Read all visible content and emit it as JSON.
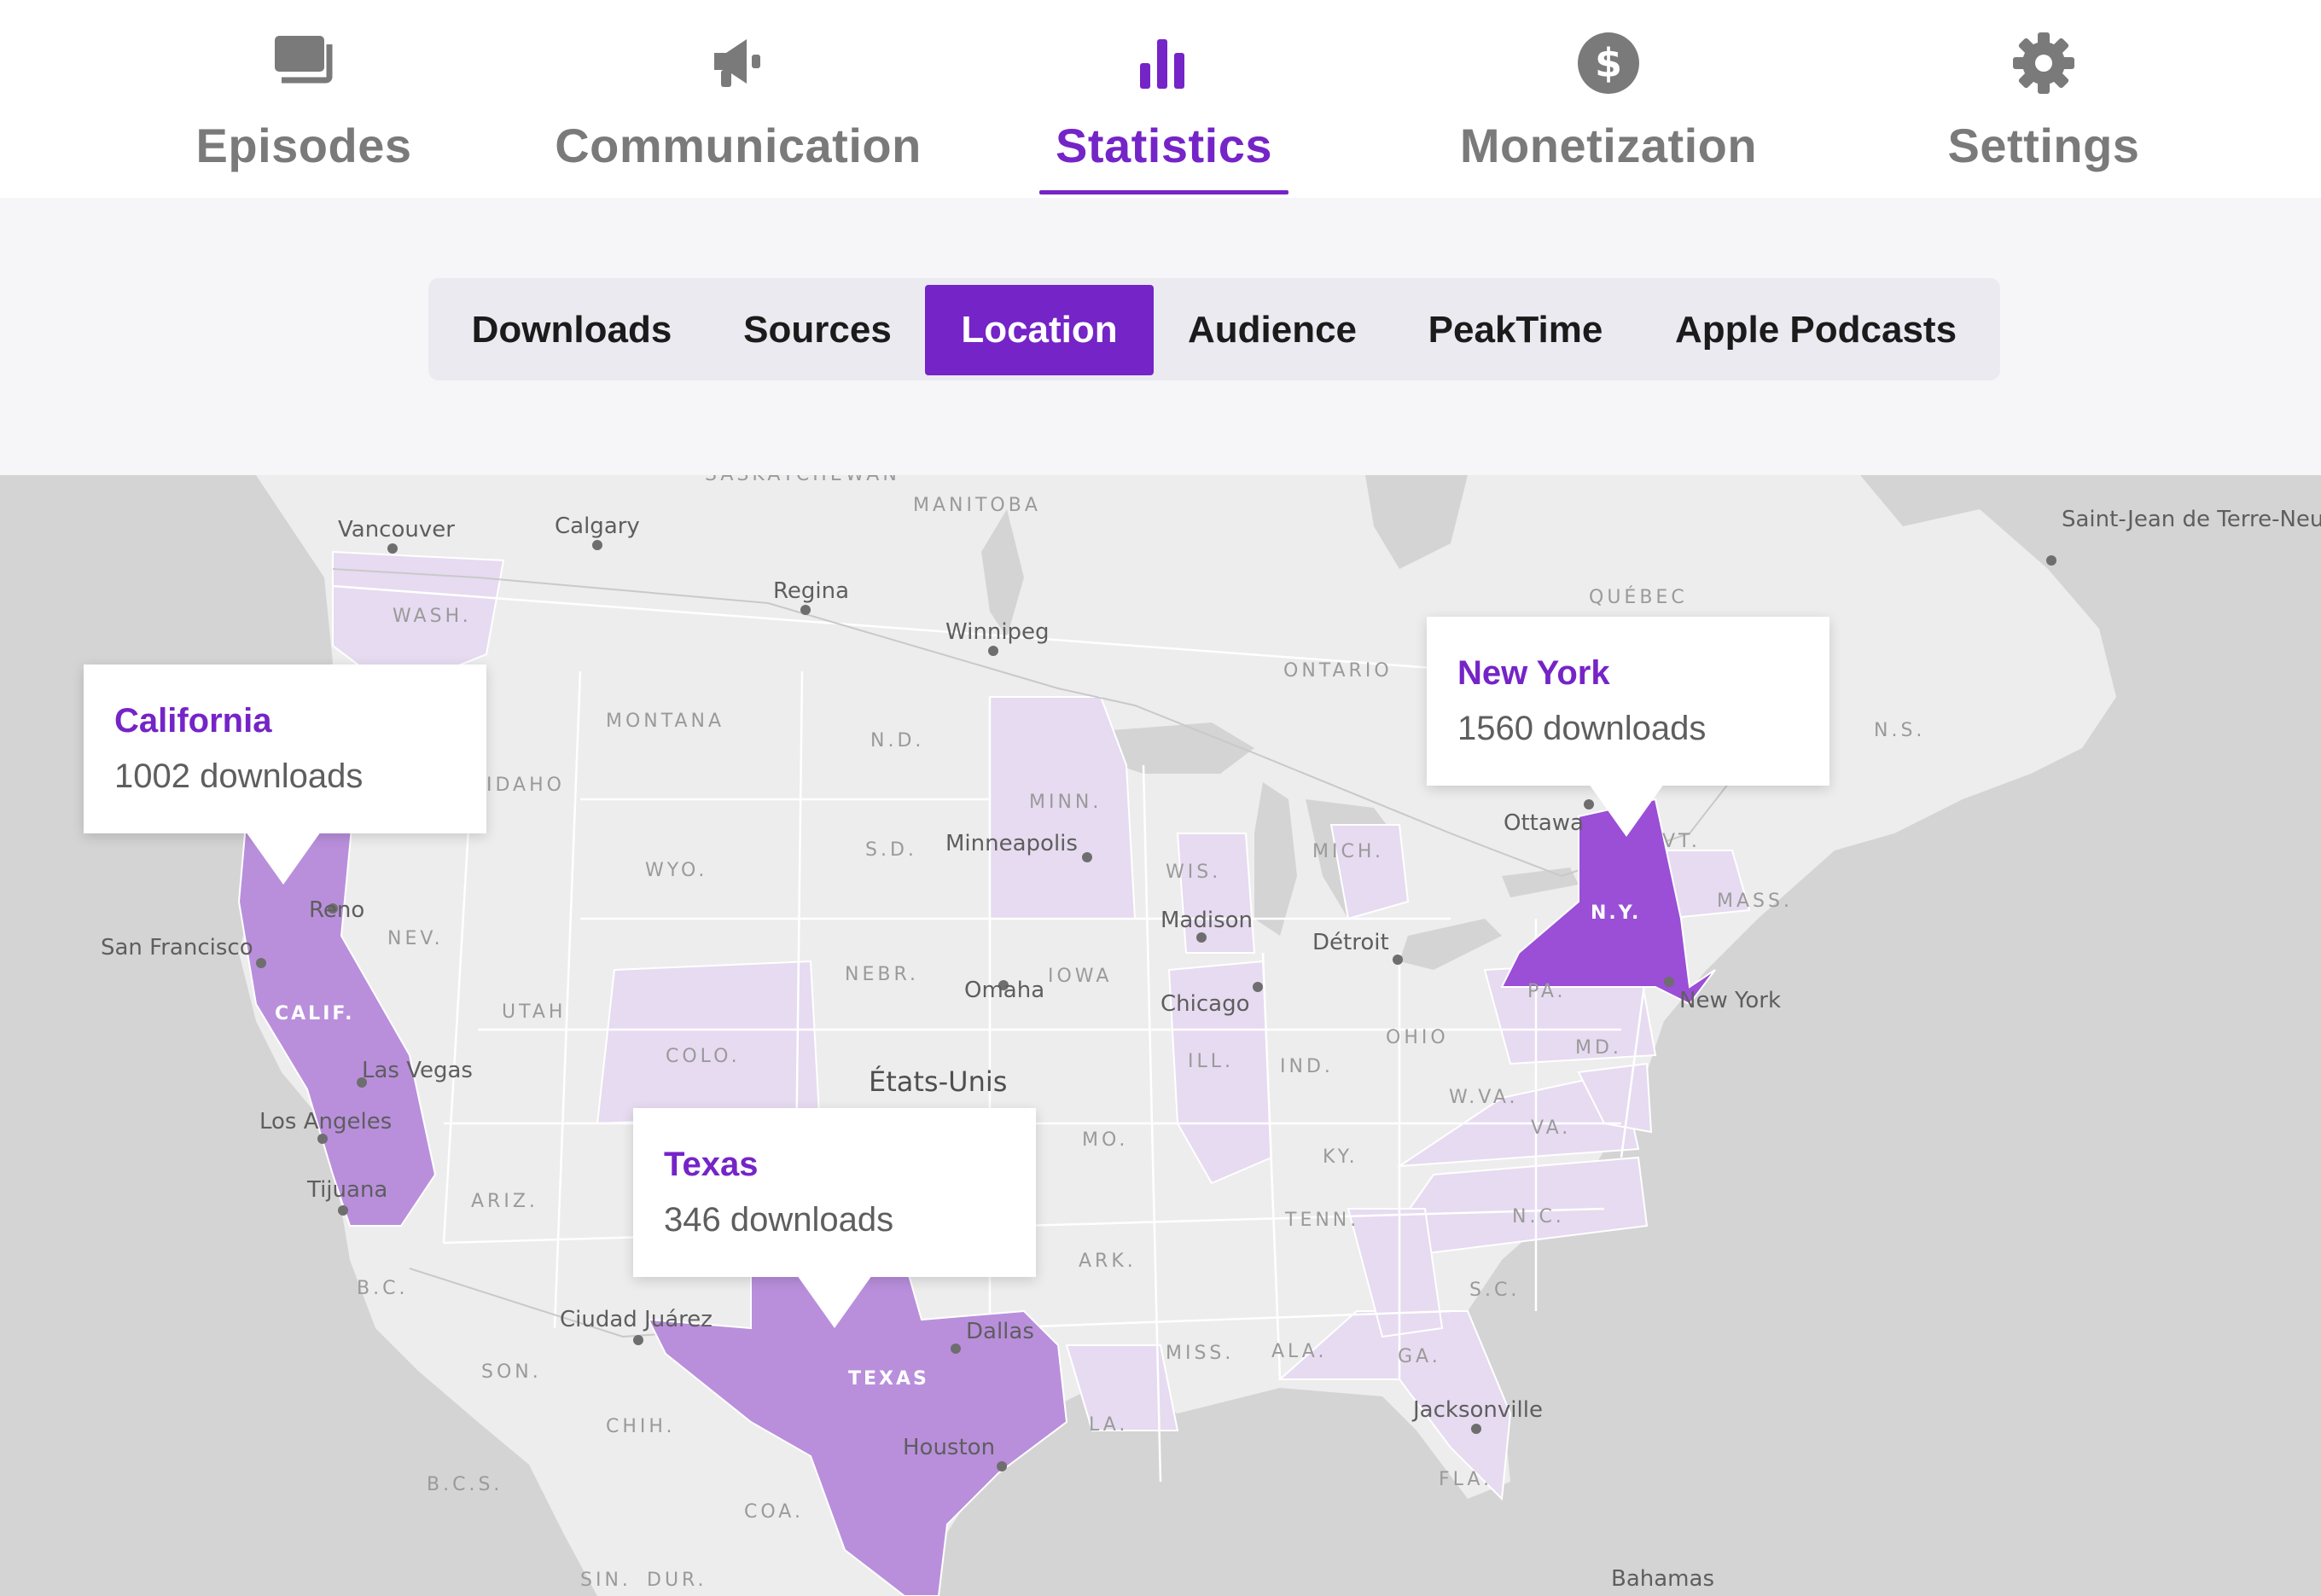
{
  "topnav": {
    "items": [
      {
        "label": "Episodes",
        "icon": "episodes-icon"
      },
      {
        "label": "Communication",
        "icon": "megaphone-icon"
      },
      {
        "label": "Statistics",
        "icon": "bar-chart-icon",
        "active": true
      },
      {
        "label": "Monetization",
        "icon": "dollar-icon"
      },
      {
        "label": "Settings",
        "icon": "gear-icon"
      }
    ]
  },
  "subtabs": {
    "items": [
      "Downloads",
      "Sources",
      "Location",
      "Audience",
      "PeakTime",
      "Apple Podcasts"
    ],
    "active": "Location"
  },
  "map": {
    "country_label": "États-Unis",
    "state_labels": [
      "WASH.",
      "MONTANA",
      "IDAHO",
      "WYO.",
      "N.D.",
      "S.D.",
      "NEBR.",
      "MINN.",
      "IOWA",
      "WIS.",
      "MICH.",
      "ILL.",
      "IND.",
      "OHIO",
      "PA.",
      "NEV.",
      "UTAH",
      "COLO.",
      "ARIZ.",
      "MO.",
      "KY.",
      "TENN.",
      "ARK.",
      "MISS.",
      "ALA.",
      "GA.",
      "S.C.",
      "N.C.",
      "VA.",
      "W.VA.",
      "MD.",
      "MASS.",
      "VT.",
      "FLA.",
      "LA.",
      "SON.",
      "CHIH.",
      "COA.",
      "B.C.",
      "B.C.S.",
      "SIN.",
      "DUR.",
      "N.S.",
      "MANITOBA",
      "ONTARIO",
      "QUÉBEC",
      "SASKATCHEWAN"
    ],
    "highlight_labels": [
      "CALIF.",
      "TEXAS",
      "N.Y."
    ],
    "cities": [
      "Vancouver",
      "Calgary",
      "Regina",
      "Winnipeg",
      "Minneapolis",
      "Madison",
      "Chicago",
      "Détroit",
      "Ottawa",
      "New York",
      "Omaha",
      "Reno",
      "San Francisco",
      "Las Vegas",
      "Los Angeles",
      "Tijuana",
      "Ciudad Juárez",
      "Dallas",
      "Houston",
      "Jacksonville",
      "Bahamas",
      "Saint-Jean de Terre-Neuve"
    ],
    "colors": {
      "land": "#ededed",
      "water": "#d4d4d4",
      "tier_high": "#9a4fd6",
      "tier_mid": "#b98fdc",
      "tier_low": "#e6dbf0"
    }
  },
  "tooltips": {
    "california": {
      "state": "California",
      "count": "1002 downloads"
    },
    "texas": {
      "state": "Texas",
      "count": "346 downloads"
    },
    "new_york": {
      "state": "New York",
      "count": "1560 downloads"
    }
  }
}
